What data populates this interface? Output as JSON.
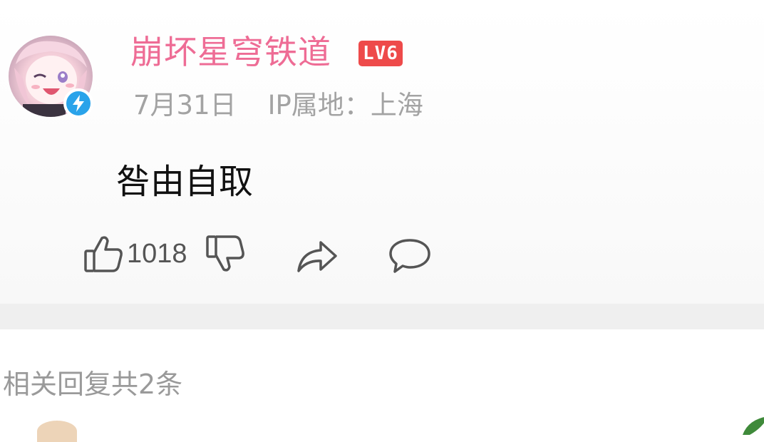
{
  "comment": {
    "username": "崩坏星穹铁道",
    "level_badge": "LV6",
    "date": "7月31日",
    "ip_location": "IP属地：上海",
    "text": "咎由自取",
    "like_count": "1018"
  },
  "replies": {
    "header": "相关回复共2条"
  },
  "colors": {
    "username": "#ee6c95",
    "level_badge": "#ee4a4a",
    "verified_badge": "#2aa3ea",
    "meta_text": "#a3a3a3",
    "divider": "#efefef"
  },
  "icons": {
    "verified": "lightning-bolt-icon",
    "like": "thumbs-up-icon",
    "dislike": "thumbs-down-icon",
    "share": "share-arrow-icon",
    "reply": "speech-bubble-icon"
  }
}
